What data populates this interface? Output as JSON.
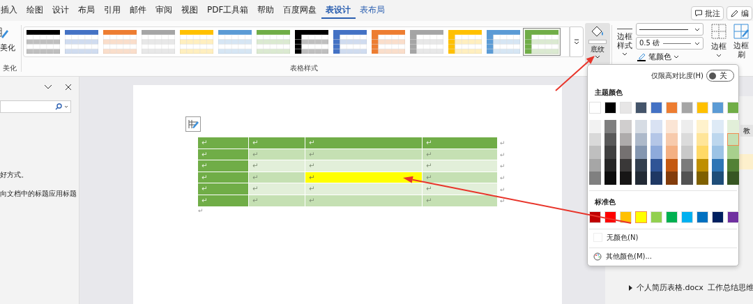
{
  "menu_tabs": [
    {
      "label": "插入",
      "selected": false,
      "contextual": false
    },
    {
      "label": "绘图",
      "selected": false,
      "contextual": false
    },
    {
      "label": "设计",
      "selected": false,
      "contextual": false
    },
    {
      "label": "布局",
      "selected": false,
      "contextual": false
    },
    {
      "label": "引用",
      "selected": false,
      "contextual": false
    },
    {
      "label": "邮件",
      "selected": false,
      "contextual": false
    },
    {
      "label": "审阅",
      "selected": false,
      "contextual": false
    },
    {
      "label": "视图",
      "selected": false,
      "contextual": false
    },
    {
      "label": "PDF工具箱",
      "selected": false,
      "contextual": false
    },
    {
      "label": "帮助",
      "selected": false,
      "contextual": false
    },
    {
      "label": "百度网盘",
      "selected": false,
      "contextual": false
    },
    {
      "label": "表设计",
      "selected": true,
      "contextual": true
    },
    {
      "label": "表布局",
      "selected": false,
      "contextual": true
    }
  ],
  "header_buttons": [
    {
      "label": "批注",
      "kind": "comment"
    },
    {
      "label": "编",
      "kind": "edit"
    }
  ],
  "ribbon": {
    "beautify": {
      "button": "美化",
      "group_label": "美化"
    },
    "styles": {
      "group_label": "表格样式",
      "items": [
        {
          "kind": "plain",
          "color": "#000000",
          "selected": false
        },
        {
          "kind": "plain",
          "color": "#4472c4",
          "selected": false
        },
        {
          "kind": "plain",
          "color": "#ed7d31",
          "selected": false
        },
        {
          "kind": "plain",
          "color": "#a5a5a5",
          "selected": false
        },
        {
          "kind": "plain",
          "color": "#ffc000",
          "selected": false
        },
        {
          "kind": "plain",
          "color": "#5b9bd5",
          "selected": false
        },
        {
          "kind": "plain",
          "color": "#70ad47",
          "selected": false
        },
        {
          "kind": "first-column",
          "color": "#000000",
          "selected": false
        },
        {
          "kind": "first-column",
          "color": "#4472c4",
          "selected": false
        },
        {
          "kind": "first-column",
          "color": "#ed7d31",
          "selected": false
        },
        {
          "kind": "first-column",
          "color": "#a5a5a5",
          "selected": false
        },
        {
          "kind": "first-column",
          "color": "#ffc000",
          "selected": false
        },
        {
          "kind": "first-column",
          "color": "#5b9bd5",
          "selected": false
        },
        {
          "kind": "first-column",
          "color": "#70ad47",
          "selected": true
        }
      ]
    },
    "shading": {
      "label": "底纹",
      "expanded": true
    },
    "borders": {
      "style_label": "边框样式",
      "weight": "0.5 磅",
      "pen_color": "笔颜色",
      "border_button": "边框",
      "painter_button": "边框刷"
    }
  },
  "navigation_pane": {
    "texts": [
      "好方式。",
      "向文档中的标题应用标题"
    ]
  },
  "document": {
    "table": {
      "rows": [
        {
          "cells": [
            {
              "text": "↵"
            },
            {
              "text": "↵"
            },
            {
              "text": "↵"
            },
            {
              "text": "↵"
            }
          ],
          "end": "↵"
        },
        {
          "cells": [
            {
              "text": "↵"
            },
            {
              "text": "↵"
            },
            {
              "text": "↵"
            },
            {
              "text": "↵"
            }
          ],
          "end": "↵"
        },
        {
          "cells": [
            {
              "text": "↵"
            },
            {
              "text": "↵"
            },
            {
              "text": "↵"
            },
            {
              "text": "↵"
            }
          ],
          "end": "↵"
        },
        {
          "cells": [
            {
              "text": "↵"
            },
            {
              "text": "↵"
            },
            {
              "text": "↵",
              "color": "#ffff00"
            },
            {
              "text": "↵"
            }
          ],
          "end": "↵"
        },
        {
          "cells": [
            {
              "text": "↵"
            },
            {
              "text": "↵"
            },
            {
              "text": "↵"
            },
            {
              "text": "↵"
            }
          ],
          "end": "↵"
        },
        {
          "cells": [
            {
              "text": "↵"
            },
            {
              "text": "↵"
            },
            {
              "text": "↵"
            },
            {
              "text": "↵"
            }
          ],
          "end": "↵"
        }
      ]
    },
    "after_mark": "↵"
  },
  "shading_menu": {
    "high_contrast": {
      "label": "仅限高对比度(H)",
      "on": false,
      "state": "关"
    },
    "theme_title": "主题颜色",
    "theme_colors": [
      {
        "color": "#ffffff",
        "selected": false,
        "shades": [
          {
            "color": "#f2f2f2",
            "selected": false
          },
          {
            "color": "#d9d9d9",
            "selected": false
          },
          {
            "color": "#bfbfbf",
            "selected": false
          },
          {
            "color": "#a6a6a6",
            "selected": false
          },
          {
            "color": "#808080",
            "selected": false
          }
        ]
      },
      {
        "color": "#000000",
        "selected": false,
        "shades": [
          {
            "color": "#7f7f7f",
            "selected": false
          },
          {
            "color": "#595959",
            "selected": false
          },
          {
            "color": "#404040",
            "selected": false
          },
          {
            "color": "#262626",
            "selected": false
          },
          {
            "color": "#0d0d0d",
            "selected": false
          }
        ]
      },
      {
        "color": "#e7e6e6",
        "selected": false,
        "shades": [
          {
            "color": "#d0cece",
            "selected": false
          },
          {
            "color": "#aeabab",
            "selected": false
          },
          {
            "color": "#757171",
            "selected": false
          },
          {
            "color": "#3a3838",
            "selected": false
          },
          {
            "color": "#171616",
            "selected": false
          }
        ]
      },
      {
        "color": "#44546a",
        "selected": false,
        "shades": [
          {
            "color": "#d6dce4",
            "selected": false
          },
          {
            "color": "#adb9ca",
            "selected": false
          },
          {
            "color": "#8496b0",
            "selected": false
          },
          {
            "color": "#333f4f",
            "selected": false
          },
          {
            "color": "#222a35",
            "selected": false
          }
        ]
      },
      {
        "color": "#4472c4",
        "selected": false,
        "shades": [
          {
            "color": "#d9e2f3",
            "selected": false
          },
          {
            "color": "#b4c6e7",
            "selected": false
          },
          {
            "color": "#8eaadb",
            "selected": false
          },
          {
            "color": "#2f5496",
            "selected": false
          },
          {
            "color": "#1f3864",
            "selected": false
          }
        ]
      },
      {
        "color": "#ed7d31",
        "selected": false,
        "shades": [
          {
            "color": "#fbe5d5",
            "selected": false
          },
          {
            "color": "#f7caac",
            "selected": false
          },
          {
            "color": "#f4b083",
            "selected": false
          },
          {
            "color": "#c45911",
            "selected": false
          },
          {
            "color": "#833c0b",
            "selected": false
          }
        ]
      },
      {
        "color": "#a5a5a5",
        "selected": false,
        "shades": [
          {
            "color": "#ededed",
            "selected": false
          },
          {
            "color": "#dbdbdb",
            "selected": false
          },
          {
            "color": "#c9c9c9",
            "selected": false
          },
          {
            "color": "#7b7b7b",
            "selected": false
          },
          {
            "color": "#525252",
            "selected": false
          }
        ]
      },
      {
        "color": "#ffc000",
        "selected": false,
        "shades": [
          {
            "color": "#fff2cc",
            "selected": false
          },
          {
            "color": "#ffe599",
            "selected": false
          },
          {
            "color": "#ffd966",
            "selected": false
          },
          {
            "color": "#bf8f00",
            "selected": false
          },
          {
            "color": "#7f6000",
            "selected": false
          }
        ]
      },
      {
        "color": "#5b9bd5",
        "selected": false,
        "shades": [
          {
            "color": "#deeaf6",
            "selected": false
          },
          {
            "color": "#bdd7ee",
            "selected": false
          },
          {
            "color": "#9cc3e5",
            "selected": false
          },
          {
            "color": "#2e75b5",
            "selected": false
          },
          {
            "color": "#1f4e79",
            "selected": false
          }
        ]
      },
      {
        "color": "#70ad47",
        "selected": false,
        "shades": [
          {
            "color": "#e2efd9",
            "selected": false
          },
          {
            "color": "#c5e0b3",
            "selected": true
          },
          {
            "color": "#a8d08d",
            "selected": false
          },
          {
            "color": "#538135",
            "selected": false
          },
          {
            "color": "#375623",
            "selected": false
          }
        ]
      }
    ],
    "standard_title": "标准色",
    "standard_colors": [
      {
        "color": "#c00000",
        "selected": false
      },
      {
        "color": "#ff0000",
        "selected": false
      },
      {
        "color": "#ffc000",
        "selected": false
      },
      {
        "color": "#ffff00",
        "selected": true
      },
      {
        "color": "#92d050",
        "selected": false
      },
      {
        "color": "#00b050",
        "selected": false
      },
      {
        "color": "#00b0f0",
        "selected": false
      },
      {
        "color": "#0070c0",
        "selected": false
      },
      {
        "color": "#002060",
        "selected": false
      },
      {
        "color": "#7030a0",
        "selected": false
      }
    ],
    "no_color": "无颜色(N)",
    "more_colors": "其他颜色(M)..."
  },
  "background_window": {
    "side_label": "教",
    "tabs": [
      "个人简历表格.docx",
      "工作总结思维"
    ]
  }
}
